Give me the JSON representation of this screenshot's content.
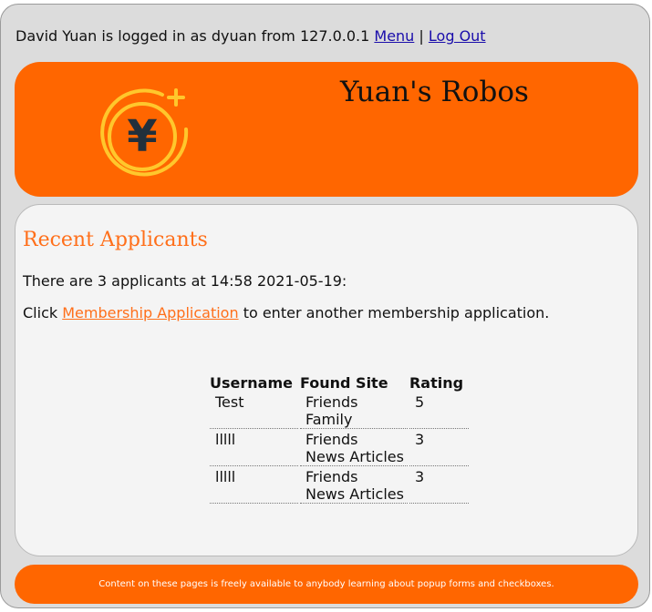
{
  "session": {
    "user_name": "David Yuan",
    "text_logged_in_as": "is logged in as",
    "login": "dyuan",
    "text_from": "from",
    "ip": "127.0.0.1",
    "menu_link": "Menu",
    "separator": "|",
    "logout_link": "Log Out"
  },
  "header": {
    "site_title": "Yuan's Robos",
    "logo_glyph": "¥",
    "logo_icon": "yen-coin-icon",
    "color": "#ff6600"
  },
  "main": {
    "heading": "Recent Applicants",
    "summary": "There are 3 applicants at 14:58 2021-05-19:",
    "click_prefix": "Click",
    "application_link": "Membership Application",
    "click_suffix": "to enter another membership application.",
    "table": {
      "headers": [
        "Username",
        "Found Site",
        "Rating"
      ],
      "rows": [
        {
          "username": "Test",
          "found_site": [
            "Friends",
            "Family"
          ],
          "rating": "5"
        },
        {
          "username": "lllll",
          "found_site": [
            "Friends",
            "News Articles"
          ],
          "rating": "3"
        },
        {
          "username": "lllll",
          "found_site": [
            "Friends",
            "News Articles"
          ],
          "rating": "3"
        }
      ]
    }
  },
  "footer": {
    "text": "Content on these pages is freely available to anybody learning about popup forms and checkboxes."
  },
  "colors": {
    "accent": "#ff6600",
    "heading": "#ff6f1a",
    "link": "#1a0dab",
    "coin": "#ffc72c"
  }
}
